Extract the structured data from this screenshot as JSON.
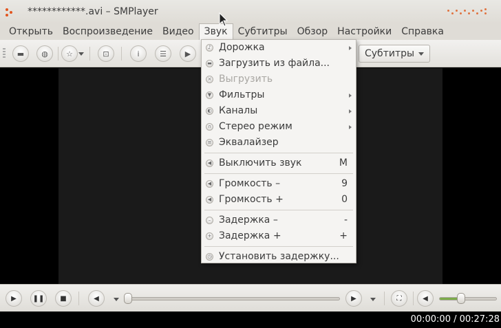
{
  "window": {
    "title": "************.avi – SMPlayer"
  },
  "menubar": {
    "items": [
      {
        "label": "Открыть"
      },
      {
        "label": "Воспроизведение"
      },
      {
        "label": "Видео"
      },
      {
        "label": "Звук",
        "active": true
      },
      {
        "label": "Субтитры"
      },
      {
        "label": "Обзор"
      },
      {
        "label": "Настройки"
      },
      {
        "label": "Справка"
      }
    ]
  },
  "toolbar": {
    "subtitles_combo": "Субтитры",
    "icons": [
      "folder-icon",
      "globe-icon",
      "star-icon",
      "screenshot-icon",
      "info-icon",
      "playlist-icon",
      "video-icon"
    ]
  },
  "audio_menu": {
    "items": [
      {
        "label": "Дорожка",
        "submenu": true,
        "icon": "track-icon"
      },
      {
        "label": "Загрузить из файла...",
        "icon": "load-file-icon"
      },
      {
        "label": "Выгрузить",
        "disabled": true,
        "icon": "unload-icon"
      },
      {
        "label": "Фильтры",
        "submenu": true,
        "icon": "filter-icon"
      },
      {
        "label": "Каналы",
        "submenu": true,
        "icon": "channels-icon"
      },
      {
        "label": "Стерео режим",
        "submenu": true,
        "icon": "stereo-icon"
      },
      {
        "label": "Эквалайзер",
        "icon": "equalizer-icon"
      },
      {
        "label": "Выключить звук",
        "shortcut": "M",
        "icon": "mute-icon"
      },
      {
        "label": "Громкость –",
        "shortcut": "9",
        "icon": "volume-down-icon"
      },
      {
        "label": "Громкость +",
        "shortcut": "0",
        "icon": "volume-up-icon"
      },
      {
        "label": "Задержка –",
        "shortcut": "-",
        "icon": "delay-minus-icon"
      },
      {
        "label": "Задержка +",
        "shortcut": "+",
        "icon": "delay-plus-icon"
      },
      {
        "label": "Установить задержку...",
        "icon": "set-delay-icon"
      }
    ]
  },
  "controls": {
    "time": "00:00:00 / 00:27:28",
    "seek_fraction": 0.0,
    "volume_fraction": 0.38
  },
  "colors": {
    "accent_orange": "#e2551f",
    "volume_green": "#7cab4a"
  }
}
